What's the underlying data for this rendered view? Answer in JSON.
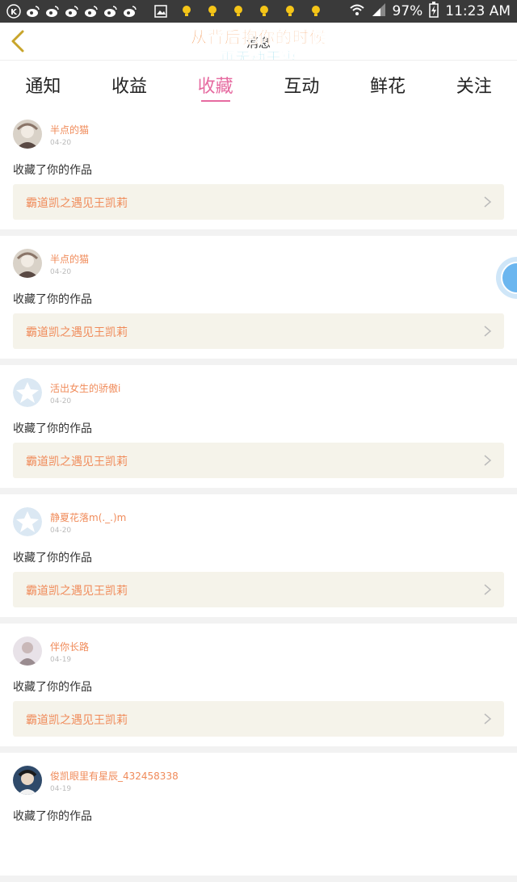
{
  "status_bar": {
    "left_icons": [
      "k-circle-icon",
      "weibo-icon",
      "weibo-icon",
      "weibo-icon",
      "weibo-icon",
      "weibo-icon",
      "weibo-icon",
      "image-icon",
      "bulb-icon",
      "bulb-icon",
      "bulb-icon",
      "bulb-icon",
      "bulb-icon",
      "bulb-icon"
    ],
    "battery": "97%",
    "time": "11:23 AM"
  },
  "header": {
    "title": "消息",
    "overlay_line1": "从背后抱你的时候",
    "overlay_line2": "再无动于衷"
  },
  "tabs": [
    {
      "label": "通知",
      "active": false
    },
    {
      "label": "收益",
      "active": false
    },
    {
      "label": "收藏",
      "active": true
    },
    {
      "label": "互动",
      "active": false
    },
    {
      "label": "鲜花",
      "active": false
    },
    {
      "label": "关注",
      "active": false
    }
  ],
  "items": [
    {
      "user": "半点的猫",
      "date": "04-20",
      "action": "收藏了你的作品",
      "work": "霸道凯之遇见王凯莉",
      "avatar": "photo"
    },
    {
      "user": "半点的猫",
      "date": "04-20",
      "action": "收藏了你的作品",
      "work": "霸道凯之遇见王凯莉",
      "avatar": "photo"
    },
    {
      "user": "活出女生的骄傲i",
      "date": "04-20",
      "action": "收藏了你的作品",
      "work": "霸道凯之遇见王凯莉",
      "avatar": "default"
    },
    {
      "user": "静夏花落m(._.)m",
      "date": "04-20",
      "action": "收藏了你的作品",
      "work": "霸道凯之遇见王凯莉",
      "avatar": "default"
    },
    {
      "user": "伴你长路",
      "date": "04-19",
      "action": "收藏了你的作品",
      "work": "霸道凯之遇见王凯莉",
      "avatar": "photo2"
    },
    {
      "user": "俊凯眼里有星辰_432458338",
      "date": "04-19",
      "action": "收藏了你的作品",
      "work": "",
      "avatar": "photo3"
    }
  ],
  "colors": {
    "accent": "#e66aa0",
    "username": "#f08b5a",
    "work_bg": "#f5f3ea"
  }
}
